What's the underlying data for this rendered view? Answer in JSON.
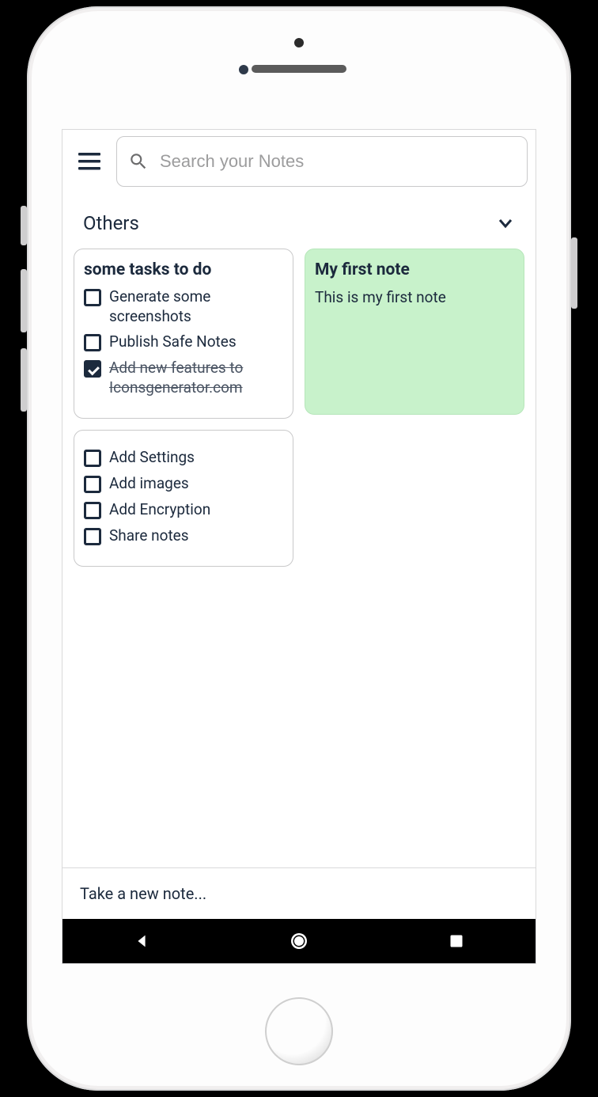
{
  "search": {
    "placeholder": "Search your Notes"
  },
  "section": {
    "title": "Others"
  },
  "notes": [
    {
      "type": "tasks",
      "title": "some tasks to do",
      "bg": "white",
      "tasks": [
        {
          "text": "Generate some screenshots",
          "done": false
        },
        {
          "text": "Publish Safe Notes",
          "done": false
        },
        {
          "text": "Add new features to Iconsgenerator.com",
          "done": true
        }
      ]
    },
    {
      "type": "tasks",
      "title": "",
      "bg": "white",
      "tasks": [
        {
          "text": "Add Settings",
          "done": false
        },
        {
          "text": "Add images",
          "done": false
        },
        {
          "text": "Add Encryption",
          "done": false
        },
        {
          "text": "Share notes",
          "done": false
        }
      ]
    },
    {
      "type": "text",
      "title": "My first note",
      "bg": "green",
      "body": "This is my first note"
    }
  ],
  "newNote": {
    "placeholder": "Take a new note..."
  },
  "icons": {
    "menu": "menu-icon",
    "search": "search-icon",
    "chevronDown": "chevron-down-icon",
    "back": "back-icon",
    "home": "home-circle-icon",
    "recent": "recent-square-icon"
  }
}
